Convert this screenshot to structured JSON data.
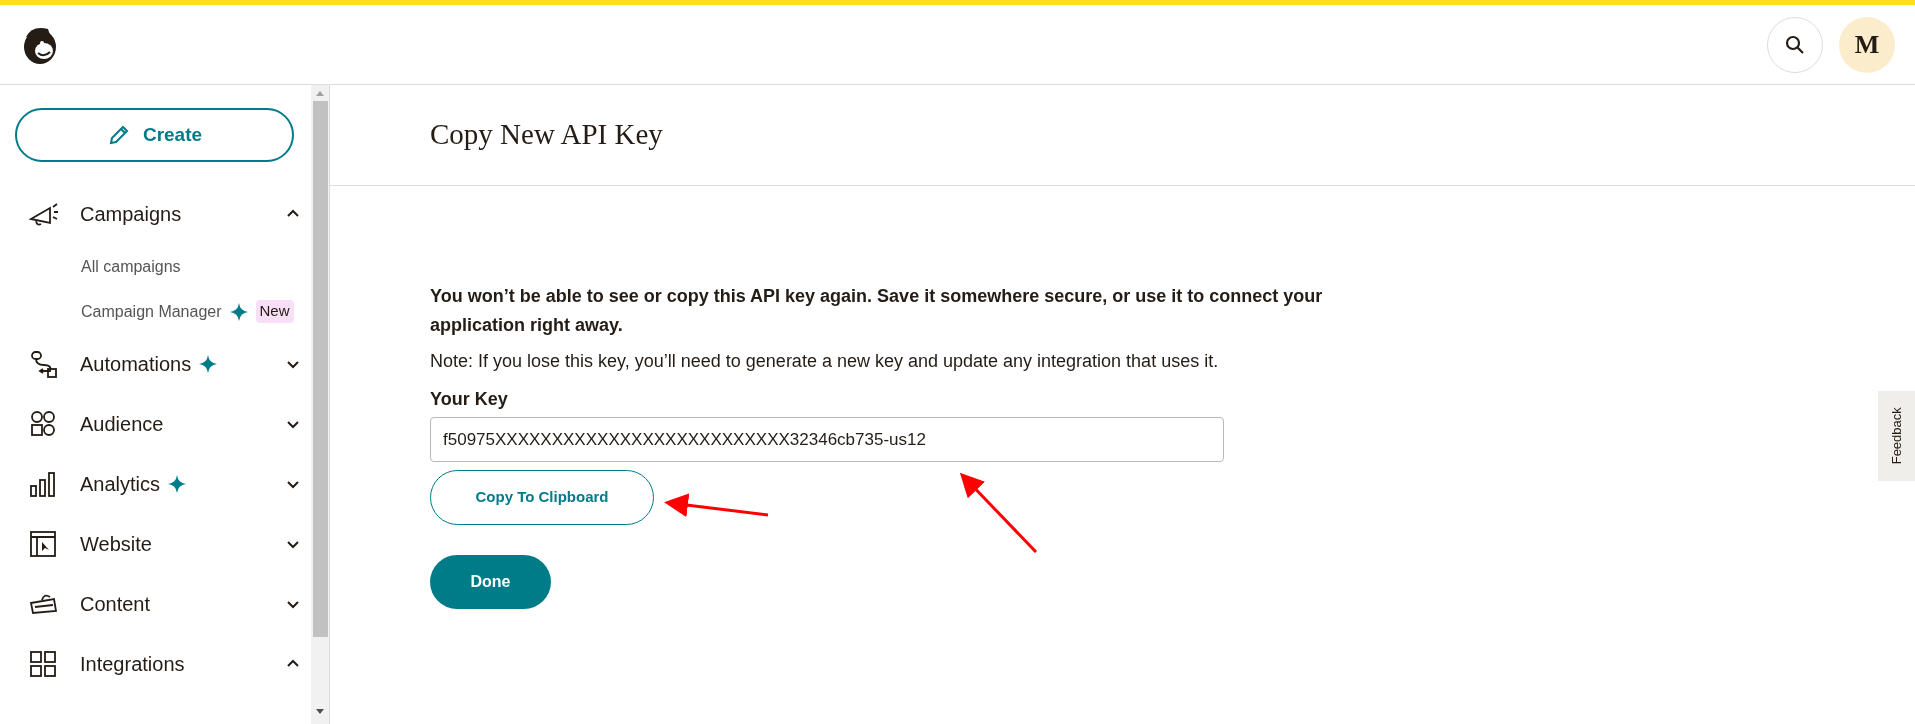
{
  "sidebar": {
    "create_button": "Create",
    "items": [
      {
        "label": "Campaigns",
        "sparkle": false,
        "expanded": true,
        "children": [
          {
            "label": "All campaigns",
            "sparkle": false
          },
          {
            "label": "Campaign Manager",
            "sparkle": true,
            "badge": "New"
          }
        ]
      },
      {
        "label": "Automations",
        "sparkle": true,
        "expanded": false
      },
      {
        "label": "Audience",
        "sparkle": false,
        "expanded": false
      },
      {
        "label": "Analytics",
        "sparkle": true,
        "expanded": false
      },
      {
        "label": "Website",
        "sparkle": false,
        "expanded": false
      },
      {
        "label": "Content",
        "sparkle": false,
        "expanded": false
      },
      {
        "label": "Integrations",
        "sparkle": false,
        "expanded": true
      }
    ]
  },
  "header": {
    "avatar": "M"
  },
  "main": {
    "title": "Copy New API Key",
    "warning": "You won’t be able to see or copy this API key again. Save it somewhere secure, or use it to connect your application right away.",
    "note": "Note: If you lose this key, you’ll need to generate a new key and update any integration that uses it.",
    "key_label": "Your Key",
    "key_value": "f50975XXXXXXXXXXXXXXXXXXXXXXXXXX32346cb735-us12",
    "copy_button": "Copy To Clipboard",
    "done_button": "Done"
  },
  "feedback_tab": "Feedback"
}
